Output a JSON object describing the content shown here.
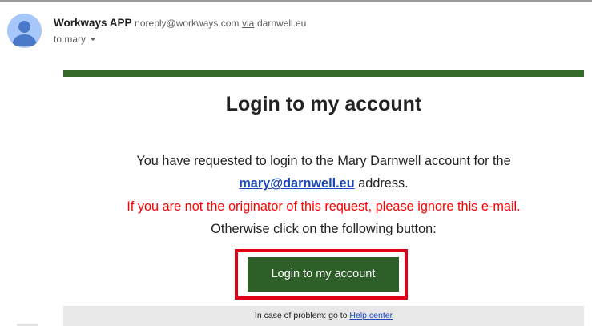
{
  "header": {
    "sender_name": "Workways APP",
    "sender_email": "noreply@workways.com",
    "via_word": "via",
    "via_domain": "darnwell.eu",
    "to_label": "to mary",
    "avatar_icon": "person-icon",
    "avatar_color": "#a8c7fa"
  },
  "email": {
    "accent_color": "#34692a",
    "title": "Login to my account",
    "para1": "You have requested to login to the Mary Darnwell account for the",
    "account_email": "mary@darnwell.eu",
    "para2_suffix": " address.",
    "warning": "If you are not the originator of this request, please ignore this e-mail.",
    "warning_color": "#ff0000",
    "para3": "Otherwise click on the following button:",
    "button_label": "Login to my account",
    "button_color": "#2f5f28",
    "highlight_color": "#e0001a",
    "footer_prefix": "In case of problem: go to ",
    "footer_link": "Help center"
  }
}
